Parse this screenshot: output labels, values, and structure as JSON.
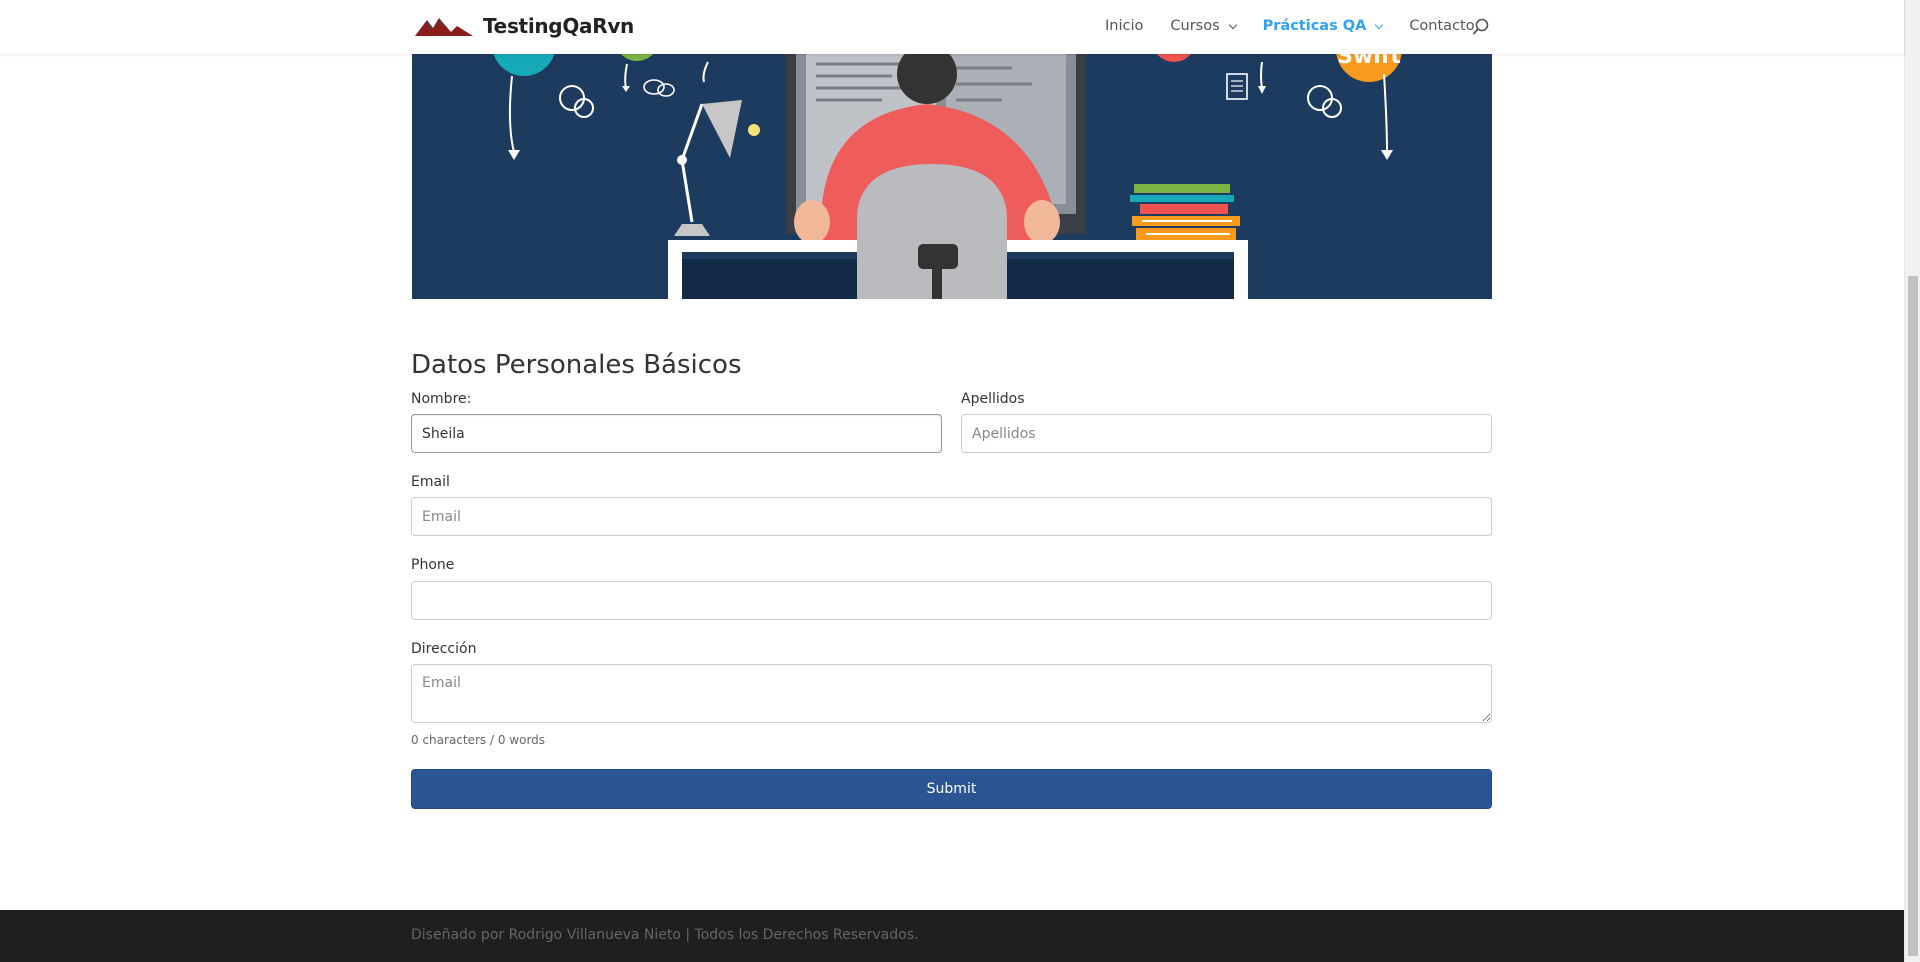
{
  "header": {
    "logo_text": "TestingQaRvn",
    "nav": [
      {
        "label": "Inicio",
        "dropdown": false,
        "active": false
      },
      {
        "label": "Cursos",
        "dropdown": true,
        "active": false
      },
      {
        "label": "Prácticas QA",
        "dropdown": true,
        "active": true
      },
      {
        "label": "Contacto",
        "dropdown": false,
        "active": false
      }
    ],
    "search_icon": "search-icon"
  },
  "hero": {
    "badge_text": "Swift"
  },
  "form": {
    "title": "Datos Personales Básicos",
    "nombre": {
      "label": "Nombre:",
      "value": "Sheila",
      "placeholder": ""
    },
    "apellidos": {
      "label": "Apellidos",
      "value": "",
      "placeholder": "Apellidos"
    },
    "email": {
      "label": "Email",
      "value": "",
      "placeholder": "Email"
    },
    "phone": {
      "label": "Phone",
      "value": "",
      "placeholder": ""
    },
    "direccion": {
      "label": "Dirección",
      "value": "",
      "placeholder": "Email"
    },
    "counter": "0 characters / 0 words",
    "submit_label": "Submit"
  },
  "footer": {
    "text": "Diseñado por Rodrigo Villanueva Nieto | Todos los Derechos Reservados."
  },
  "colors": {
    "accent": "#2ea3f2",
    "submit_bg": "#2b5493",
    "hero_bg": "#1d3a5f",
    "footer_bg": "#1f1f1f"
  }
}
